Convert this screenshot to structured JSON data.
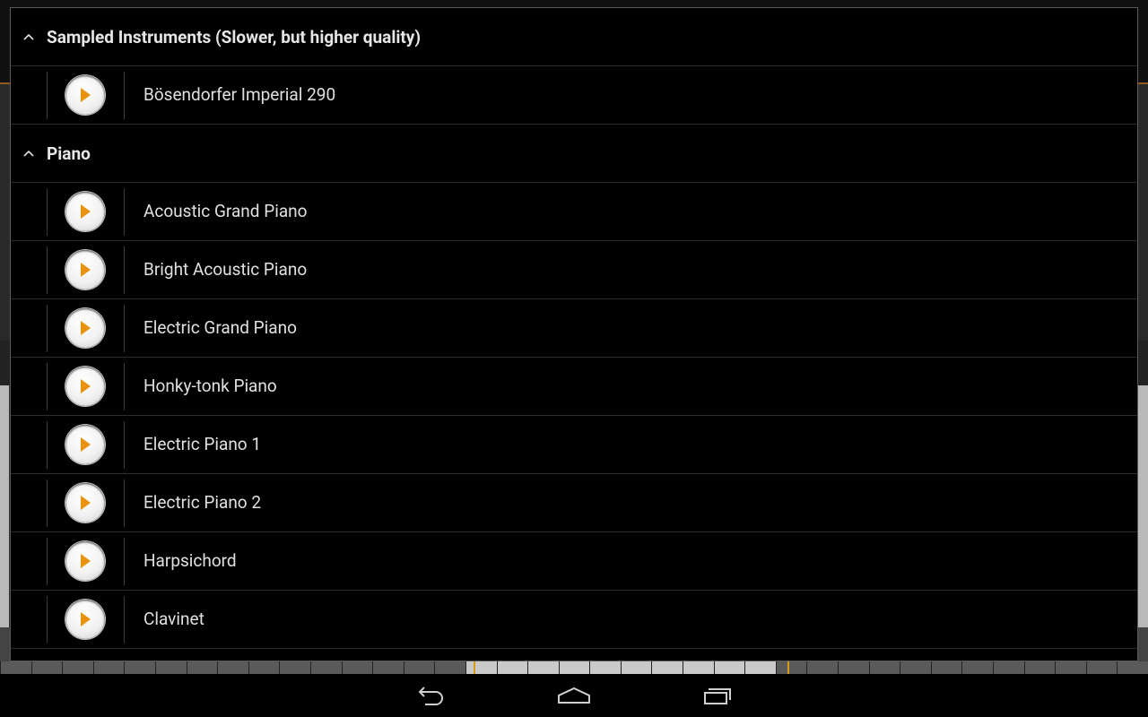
{
  "groups": [
    {
      "title": "Sampled Instruments (Slower, but higher quality)",
      "items": [
        "Bösendorfer Imperial 290"
      ]
    },
    {
      "title": "Piano",
      "items": [
        "Acoustic Grand Piano",
        "Bright Acoustic Piano",
        "Electric Grand Piano",
        "Honky-tonk Piano",
        "Electric Piano 1",
        "Electric Piano 2",
        "Harpsichord",
        "Clavinet"
      ]
    }
  ],
  "icons": {
    "group_toggle": "chevron-up-icon",
    "preview": "play-icon",
    "nav_back": "back-icon",
    "nav_home": "home-icon",
    "nav_recents": "recents-icon"
  },
  "colors": {
    "accent": "#e8920f",
    "dialog_bg": "#000000",
    "divider": "#2c2c2c"
  }
}
